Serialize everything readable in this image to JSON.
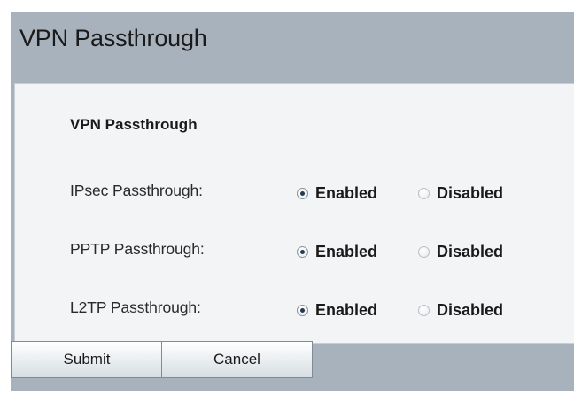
{
  "header": {
    "title": "VPN Passthrough"
  },
  "panel": {
    "heading": "VPN Passthrough",
    "rows": [
      {
        "label": "IPsec Passthrough:",
        "enabled_label": "Enabled",
        "disabled_label": "Disabled",
        "selected": "Enabled"
      },
      {
        "label": "PPTP Passthrough:",
        "enabled_label": "Enabled",
        "disabled_label": "Disabled",
        "selected": "Enabled"
      },
      {
        "label": "L2TP Passthrough:",
        "enabled_label": "Enabled",
        "disabled_label": "Disabled",
        "selected": "Enabled"
      }
    ]
  },
  "buttons": {
    "submit": "Submit",
    "cancel": "Cancel"
  }
}
